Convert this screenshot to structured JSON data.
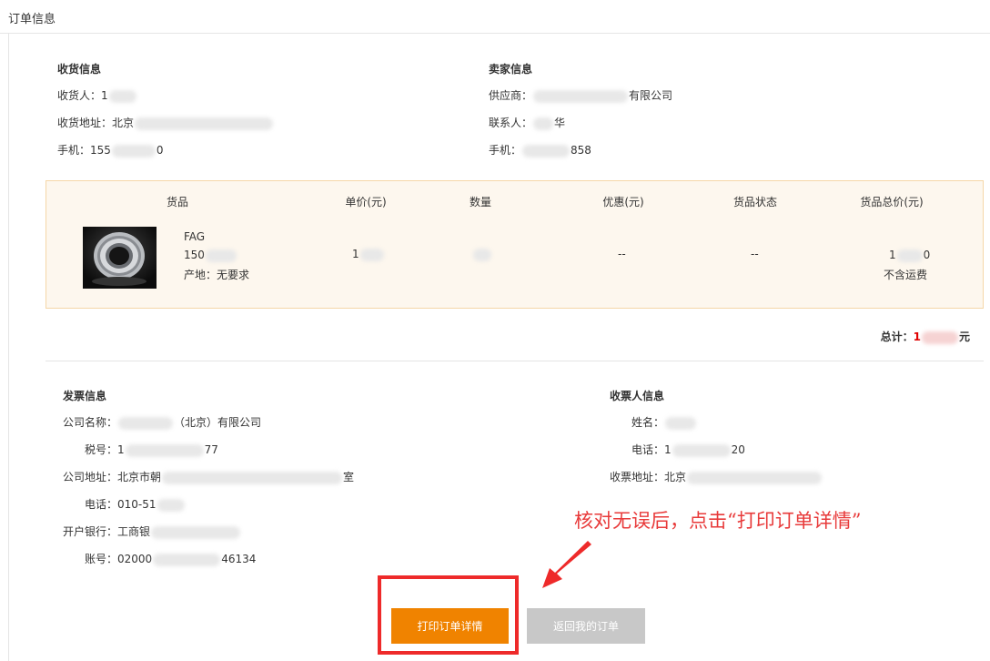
{
  "page_title": "订单信息",
  "receiver": {
    "title": "收货信息",
    "name_label": "收货人：",
    "name_value": "1",
    "address_label": "收货地址：",
    "address_value": "北京",
    "phone_label": "手机：",
    "phone_prefix": "155",
    "phone_suffix": "0"
  },
  "seller": {
    "title": "卖家信息",
    "supplier_label": "供应商：",
    "supplier_suffix": "有限公司",
    "contact_label": "联系人：",
    "contact_suffix": "华",
    "phone_label": "手机：",
    "phone_suffix": "858"
  },
  "goods_table": {
    "headers": [
      "货品",
      "单价(元)",
      "数量",
      "优惠(元)",
      "货品状态",
      "货品总价(元)"
    ],
    "row": {
      "brand": "FAG",
      "model_prefix": "150",
      "origin": "产地：无要求",
      "unit_price": "1",
      "quantity": "",
      "discount": "--",
      "status": "--",
      "total_prefix": "1",
      "total_suffix": "0",
      "shipping_note": "不含运费"
    }
  },
  "total": {
    "label": "总计：",
    "value_prefix": "1",
    "unit": "元"
  },
  "invoice": {
    "title": "发票信息",
    "company_label": "公司名称：",
    "company_suffix": "（北京）有限公司",
    "tax_label": "税号：",
    "tax_prefix": "1",
    "tax_suffix": "77",
    "address_label": "公司地址：",
    "address_prefix": "北京市朝",
    "address_suffix": "室",
    "tel_label": "电话：",
    "tel_prefix": "010-51",
    "bank_label": "开户银行：",
    "bank_prefix": "工商银",
    "account_label": "账号：",
    "account_prefix": "02000",
    "account_suffix": "46134"
  },
  "invoice_receiver": {
    "title": "收票人信息",
    "name_label": "姓名：",
    "phone_label": "电话：",
    "phone_prefix": "1",
    "phone_suffix": "20",
    "address_label": "收票地址：",
    "address_prefix": "北京"
  },
  "buttons": {
    "print": "打印订单详情",
    "back": "返回我的订单"
  },
  "annotation": "核对无误后，点击“打印订单详情”",
  "colors": {
    "accent": "#f08300",
    "highlight": "#ee2a2a",
    "price": "#e00000",
    "goods_bg": "#fdf7ee"
  }
}
